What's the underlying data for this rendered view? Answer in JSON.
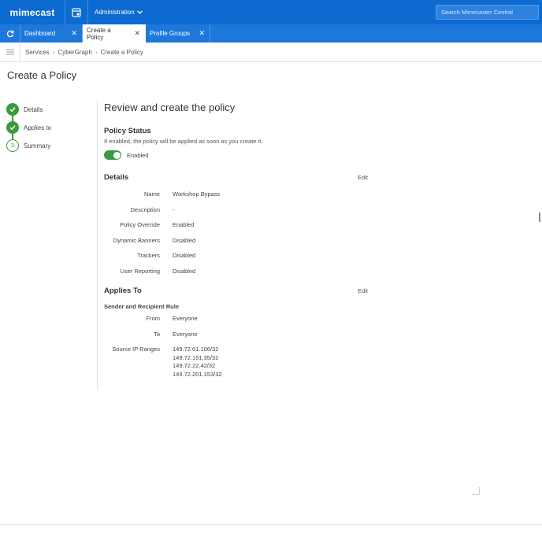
{
  "colors": {
    "topbar": "#0c6ad1",
    "tabbar": "#1e78dc",
    "success": "#3a9a3e"
  },
  "topbar": {
    "logo": "mimecast",
    "apps_icon": "apps-grid-icon",
    "admin_menu": "Administration",
    "search_placeholder": "Search Mimecaster Central"
  },
  "tabs": [
    {
      "label": "Dashboard",
      "active": false
    },
    {
      "label": "Create a Policy",
      "active": true
    },
    {
      "label": "Profile Groups",
      "active": false
    }
  ],
  "breadcrumb": [
    "Services",
    "CyberGraph",
    "Create a Policy"
  ],
  "page_title": "Create a Policy",
  "stepper": [
    {
      "label": "Details",
      "state": "done"
    },
    {
      "label": "Applies to",
      "state": "done"
    },
    {
      "label": "Summary",
      "state": "current",
      "number": "3"
    }
  ],
  "review": {
    "heading": "Review and create the policy",
    "policy_status": {
      "title": "Policy Status",
      "description": "If enabled, the policy will be applied as soon as you create it.",
      "toggle_label": "Enabled",
      "enabled": true
    },
    "details": {
      "title": "Details",
      "edit_label": "Edit",
      "rows": [
        {
          "key": "Name",
          "value": "Workshop Bypass"
        },
        {
          "key": "Description",
          "value": "-"
        },
        {
          "key": "Policy Override",
          "value": "Enabled"
        },
        {
          "key": "Dynamic Banners",
          "value": "Disabled"
        },
        {
          "key": "Trackers",
          "value": "Disabled"
        },
        {
          "key": "User Reporting",
          "value": "Disabled"
        }
      ]
    },
    "applies_to": {
      "title": "Applies To",
      "edit_label": "Edit",
      "rule_title": "Sender and Recipient Rule",
      "from_label": "From",
      "from_value": "Everyone",
      "to_label": "To",
      "to_value": "Everyone",
      "ip_label": "Source IP Ranges",
      "ip_ranges": [
        "149.72.61.106/32",
        "149.72.151.35/32",
        "149.72.22.42/32",
        "149.72.201.153/32"
      ]
    }
  }
}
